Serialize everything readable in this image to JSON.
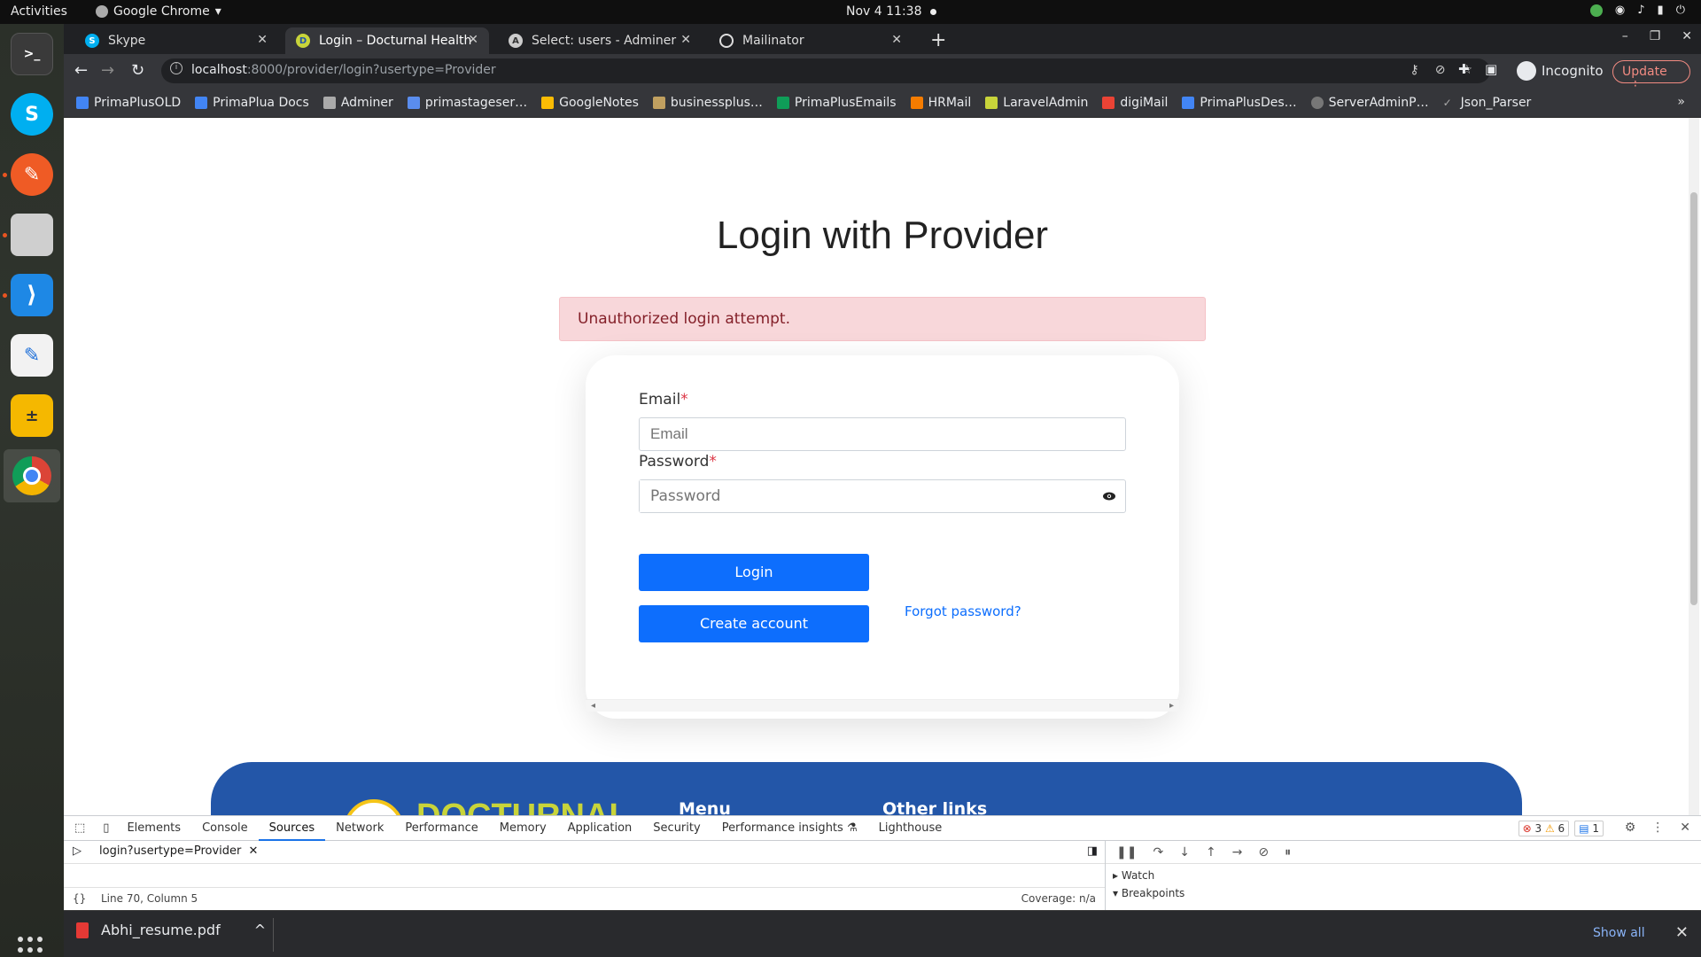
{
  "system": {
    "activities": "Activities",
    "app_name": "Google Chrome",
    "clock": "Nov 4  11:38"
  },
  "tabs": [
    {
      "title": "Skype",
      "favicon": "skype-icon"
    },
    {
      "title": "Login – Docturnal Health",
      "favicon": "docturnal-icon"
    },
    {
      "title": "Select: users - Adminer",
      "favicon": "adminer-icon"
    },
    {
      "title": "Mailinator",
      "favicon": "globe-icon"
    }
  ],
  "address_bar": {
    "host": "localhost",
    "path": ":8000/provider/login?usertype=Provider",
    "profile": "Incognito",
    "update_label": "Update"
  },
  "bookmarks": [
    "PrimaPlusOLD",
    "PrimaPlua Docs",
    "Adminer",
    "primastageser…",
    "GoogleNotes",
    "businessplus…",
    "PrimaPlusEmails",
    "HRMail",
    "LaravelAdmin",
    "digiMail",
    "PrimaPlusDes…",
    "ServerAdminP…",
    "Json_Parser"
  ],
  "page": {
    "title": "Login with Provider",
    "alert": "Unauthorized login attempt.",
    "email_label": "Email",
    "email_placeholder": "Email",
    "password_label": "Password",
    "password_placeholder": "Password",
    "required_mark": "*",
    "login_button": "Login",
    "forgot_link": "Forgot password?",
    "create_button": "Create account",
    "footer": {
      "brand": "DOCTURNAL",
      "menu_heading": "Menu",
      "links_heading": "Other links"
    }
  },
  "devtools": {
    "tabs": [
      "Elements",
      "Console",
      "Sources",
      "Network",
      "Performance",
      "Memory",
      "Application",
      "Security",
      "Performance insights",
      "Lighthouse"
    ],
    "active_tab": "Sources",
    "errors": "3",
    "warnings": "6",
    "messages": "1",
    "open_file": "login?usertype=Provider",
    "cursor_position": "Line 70, Column 5",
    "coverage": "Coverage: n/a",
    "watch_label": "Watch",
    "breakpoints_label": "Breakpoints"
  },
  "downloads": {
    "file": "Abhi_resume.pdf",
    "show_all": "Show all"
  },
  "colors": {
    "primary_button": "#0d6efd",
    "alert_bg": "#f8d7da",
    "footer_bg": "#2356a8",
    "brand_text": "#c8d43a"
  }
}
